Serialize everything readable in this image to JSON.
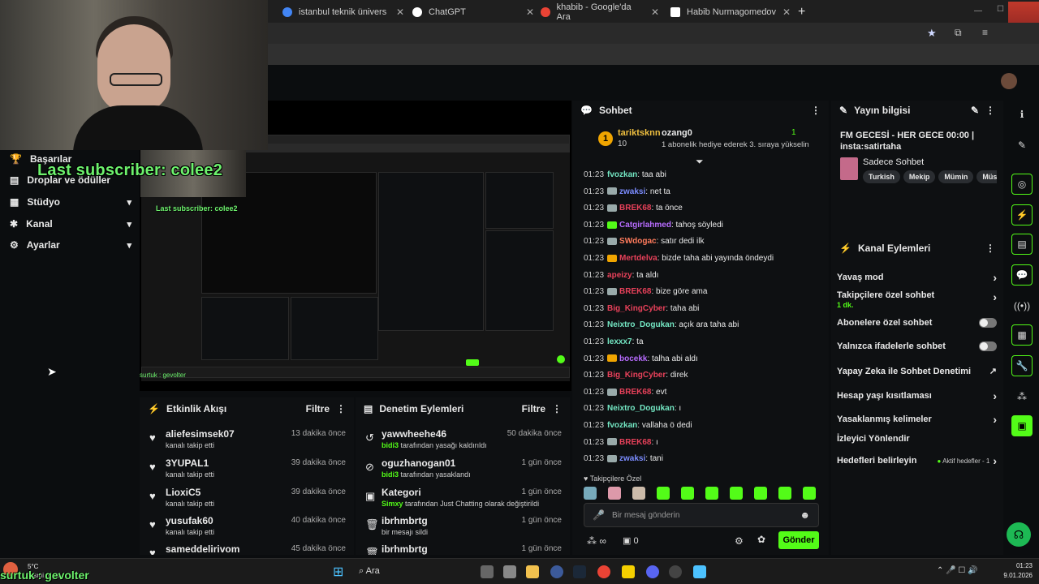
{
  "browser": {
    "tabs": [
      {
        "title": "istanbul teknik üniversitesi deki",
        "color": "#4285f4"
      },
      {
        "title": "ChatGPT",
        "color": "#ffffff"
      },
      {
        "title": "khabib - Google'da Ara",
        "color": "#ea4335"
      },
      {
        "title": "Habib Nurmagomedov - Vikipe",
        "color": "#ffffff"
      }
    ],
    "new_tab": "+"
  },
  "overlay": {
    "last_subscriber": "Last subscriber: colee2",
    "preview_last_subscriber": "Last subscriber: colee2",
    "bottom_watermark": "surtuk : gevolter",
    "preview_watermark": "surtuk : gevolter"
  },
  "sidebar": {
    "items": [
      {
        "label": "Başarılar",
        "icon": "trophy-icon",
        "glyph": "🏆",
        "chevron": false
      },
      {
        "label": "Droplar ve ödüller",
        "icon": "gift-icon",
        "glyph": "▤",
        "chevron": false
      },
      {
        "label": "Stüdyo",
        "icon": "studio-icon",
        "glyph": "▦",
        "chevron": true
      },
      {
        "label": "Kanal",
        "icon": "channel-icon",
        "glyph": "✱",
        "chevron": true
      },
      {
        "label": "Ayarlar",
        "icon": "gear-icon",
        "glyph": "⚙",
        "chevron": true
      }
    ]
  },
  "activity": {
    "title": "Etkinlik Akışı",
    "filter": "Filtre",
    "items": [
      {
        "name": "aliefesimsek07",
        "sub": "kanalı takip etti",
        "time": "13 dakika önce"
      },
      {
        "name": "3YUPAL1",
        "sub": "kanalı takip etti",
        "time": "39 dakika önce"
      },
      {
        "name": "LioxiC5",
        "sub": "kanalı takip etti",
        "time": "39 dakika önce"
      },
      {
        "name": "yusufak60",
        "sub": "kanalı takip etti",
        "time": "40 dakika önce"
      },
      {
        "name": "sameddelirivom",
        "sub": "",
        "time": "45 dakika önce"
      }
    ]
  },
  "moderation": {
    "title": "Denetim Eylemleri",
    "filter": "Filtre",
    "items": [
      {
        "name": "yawwheehe46",
        "actor": "bidi3",
        "sub": "tarafından yasağı kaldırıldı",
        "time": "50 dakika önce",
        "glyph": "↺"
      },
      {
        "name": "oguzhanogan01",
        "actor": "bidi3",
        "sub": "tarafından yasaklandı",
        "time": "1 gün önce",
        "glyph": "⊘"
      },
      {
        "name": "Kategori",
        "actor": "Simxy",
        "sub": "tarafından Just Chatting olarak değiştirildi",
        "time": "1 gün önce",
        "glyph": "▣"
      },
      {
        "name": "ibrhmbrtg",
        "actor": "",
        "sub": "bir mesajı sildi",
        "time": "1 gün önce",
        "glyph": "🗑"
      },
      {
        "name": "ibrhmbrtg",
        "actor": "",
        "sub": "",
        "time": "1 gün önce",
        "glyph": "🗑"
      }
    ]
  },
  "chat": {
    "title": "Sohbet",
    "gift_user": "tariktsknn",
    "gift_count": "10",
    "gift_rank": "1",
    "gift_target": "ozang0",
    "gift_number": "1",
    "gift_text": "1 abonelik hediye ederek 3. sıraya yükselin",
    "messages": [
      {
        "time": "01:23",
        "user": "fvozkan",
        "color": "#74e8c4",
        "text": ": taa abi",
        "badge": ""
      },
      {
        "time": "01:23",
        "user": "zwaksi",
        "color": "#7b8cff",
        "text": ": net ta",
        "badge": "#9aa"
      },
      {
        "time": "01:23",
        "user": "BREK68",
        "color": "#e8415a",
        "text": ": ta önce",
        "badge": "#9aa"
      },
      {
        "time": "01:23",
        "user": "Catgirlahmed",
        "color": "#b86cff",
        "text": ": tahoş söyledi",
        "badge": "#53fc18"
      },
      {
        "time": "01:23",
        "user": "SWdogac",
        "color": "#ff7b5c",
        "text": ": satır dedi ilk",
        "badge": "#9aa"
      },
      {
        "time": "01:23",
        "user": "Mertdelva",
        "color": "#e8415a",
        "text": ": bizde taha abi yayında öndeydi",
        "badge": "#f0a500"
      },
      {
        "time": "01:23",
        "user": "apeizy",
        "color": "#e8415a",
        "text": ": ta aldı",
        "badge": ""
      },
      {
        "time": "01:23",
        "user": "BREK68",
        "color": "#e8415a",
        "text": ": bize göre ama",
        "badge": "#9aa"
      },
      {
        "time": "01:23",
        "user": "Big_KingCyber",
        "color": "#e8415a",
        "text": ": taha abi",
        "badge": ""
      },
      {
        "time": "01:23",
        "user": "Neixtro_Dogukan",
        "color": "#74e8c4",
        "text": ": açık ara taha abi",
        "badge": ""
      },
      {
        "time": "01:23",
        "user": "lexxx7",
        "color": "#74e8c4",
        "text": ": ta",
        "badge": ""
      },
      {
        "time": "01:23",
        "user": "bocekk",
        "color": "#b86cff",
        "text": ": talha abi aldı",
        "badge": "#f0a500"
      },
      {
        "time": "01:23",
        "user": "Big_KingCyber",
        "color": "#e8415a",
        "text": ": direk",
        "badge": ""
      },
      {
        "time": "01:23",
        "user": "BREK68",
        "color": "#e8415a",
        "text": ": evt",
        "badge": "#9aa"
      },
      {
        "time": "01:23",
        "user": "Neixtro_Dogukan",
        "color": "#74e8c4",
        "text": ": ı",
        "badge": ""
      },
      {
        "time": "01:23",
        "user": "fvozkan",
        "color": "#74e8c4",
        "text": ": vallaha ö dedi",
        "badge": ""
      },
      {
        "time": "01:23",
        "user": "BREK68",
        "color": "#e8415a",
        "text": ": ı",
        "badge": "#9aa"
      },
      {
        "time": "01:23",
        "user": "zwaksi",
        "color": "#7b8cff",
        "text": ": tani",
        "badge": "#9aa"
      }
    ],
    "followers_label": "Takipçilere Özel",
    "input_placeholder": "Bir mesaj gönderin",
    "points": "0",
    "send": "Gönder"
  },
  "stream_info": {
    "title": "Yayın bilgisi",
    "stream_title": "FM GECESİ - HER GECE 00:00 | insta:satirtaha",
    "category": "Sadece Sohbet",
    "tags": [
      "Turkish",
      "Mekip",
      "Mümin",
      "Müslüm"
    ]
  },
  "channel_actions": {
    "title": "Kanal Eylemleri",
    "rows": [
      {
        "label": "Yavaş mod",
        "kind": "arrow",
        "sub": ""
      },
      {
        "label": "Takipçilere özel sohbet",
        "kind": "arrow",
        "sub": "1 dk."
      },
      {
        "label": "Abonelere özel sohbet",
        "kind": "toggle",
        "sub": ""
      },
      {
        "label": "Yalnızca ifadelerle sohbet",
        "kind": "toggle",
        "sub": ""
      },
      {
        "label": "Yapay Zeka ile Sohbet Denetimi",
        "kind": "ext",
        "sub": ""
      },
      {
        "label": "Hesap yaşı kısıtlaması",
        "kind": "arrow",
        "sub": ""
      },
      {
        "label": "Yasaklanmış kelimeler",
        "kind": "arrow",
        "sub": ""
      },
      {
        "label": "İzleyici Yönlendir",
        "kind": "none",
        "sub": ""
      },
      {
        "label": "Hedefleri belirleyin",
        "kind": "arrow",
        "sub": "Aktif hedefler - 1"
      }
    ]
  },
  "taskbar": {
    "weather_temp": "5°C",
    "weather_text": "Kısmi bulut",
    "search": "Ara",
    "time": "01:23",
    "date": "9.01.2026"
  }
}
